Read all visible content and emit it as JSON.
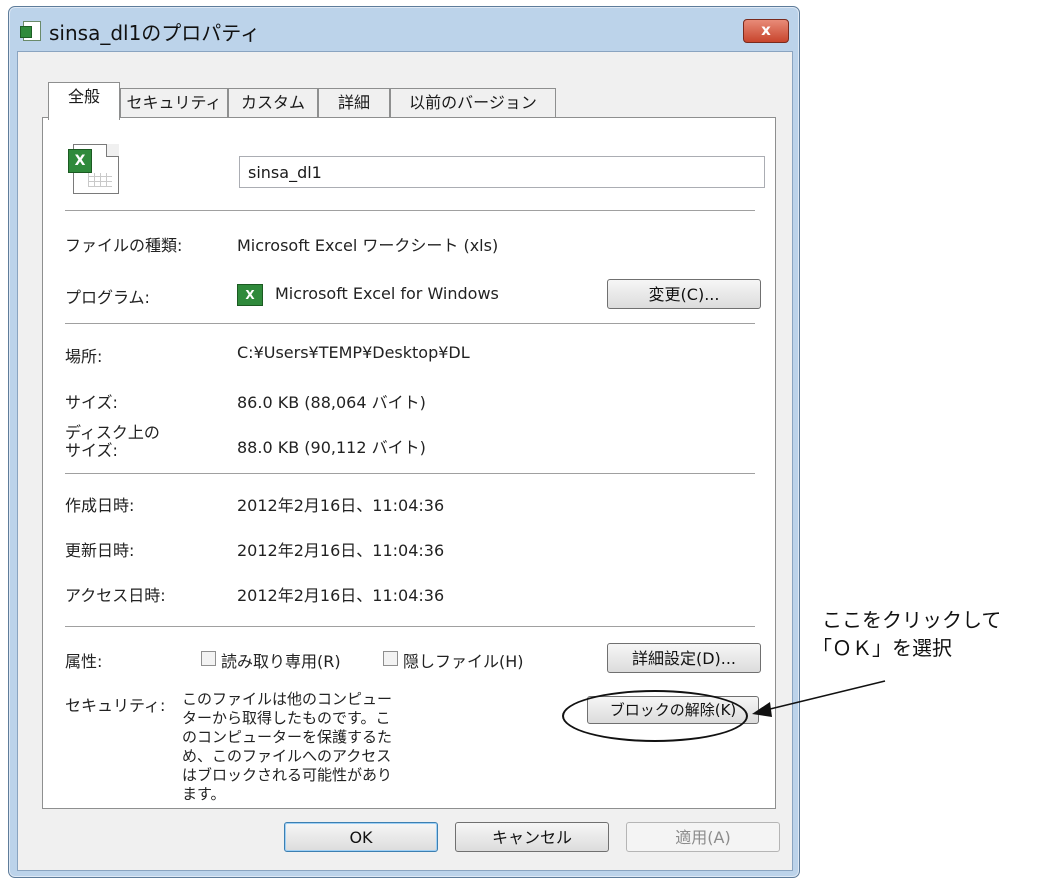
{
  "window": {
    "title": "sinsa_dl1のプロパティ",
    "close_label": "x"
  },
  "tabs": [
    {
      "label": "全般",
      "active": true
    },
    {
      "label": "セキュリティ",
      "active": false
    },
    {
      "label": "カスタム",
      "active": false
    },
    {
      "label": "詳細",
      "active": false
    },
    {
      "label": "以前のバージョン",
      "active": false
    }
  ],
  "general": {
    "file_name": "sinsa_dl1",
    "rows": {
      "file_type": {
        "label": "ファイルの種類:",
        "value": "Microsoft Excel ワークシート (xls)"
      },
      "program": {
        "label": "プログラム:",
        "value": "Microsoft Excel for Windows",
        "change_button": "変更(C)..."
      },
      "location": {
        "label": "場所:",
        "value": "C:¥Users¥TEMP¥Desktop¥DL"
      },
      "size": {
        "label": "サイズ:",
        "value": "86.0 KB (88,064 バイト)"
      },
      "size_on_disk": {
        "label": "ディスク上のサイズ:",
        "value": "88.0 KB (90,112 バイト)"
      },
      "created": {
        "label": "作成日時:",
        "value": "2012年2月16日、11:04:36"
      },
      "modified": {
        "label": "更新日時:",
        "value": "2012年2月16日、11:04:36"
      },
      "accessed": {
        "label": "アクセス日時:",
        "value": "2012年2月16日、11:04:36"
      }
    },
    "attributes": {
      "label": "属性:",
      "readonly": "読み取り専用(R)",
      "hidden": "隠しファイル(H)",
      "advanced_button": "詳細設定(D)..."
    },
    "security": {
      "label": "セキュリティ:",
      "text": "このファイルは他のコンピューターから取得したものです。このコンピューターを保護するため、このファイルへのアクセスはブロックされる可能性があります。",
      "unblock_button": "ブロックの解除(K)"
    }
  },
  "footer": {
    "ok": "OK",
    "cancel": "キャンセル",
    "apply": "適用(A)"
  },
  "annotation": {
    "line1": "ここをクリックして",
    "line2": "「ＯＫ」を選択"
  }
}
